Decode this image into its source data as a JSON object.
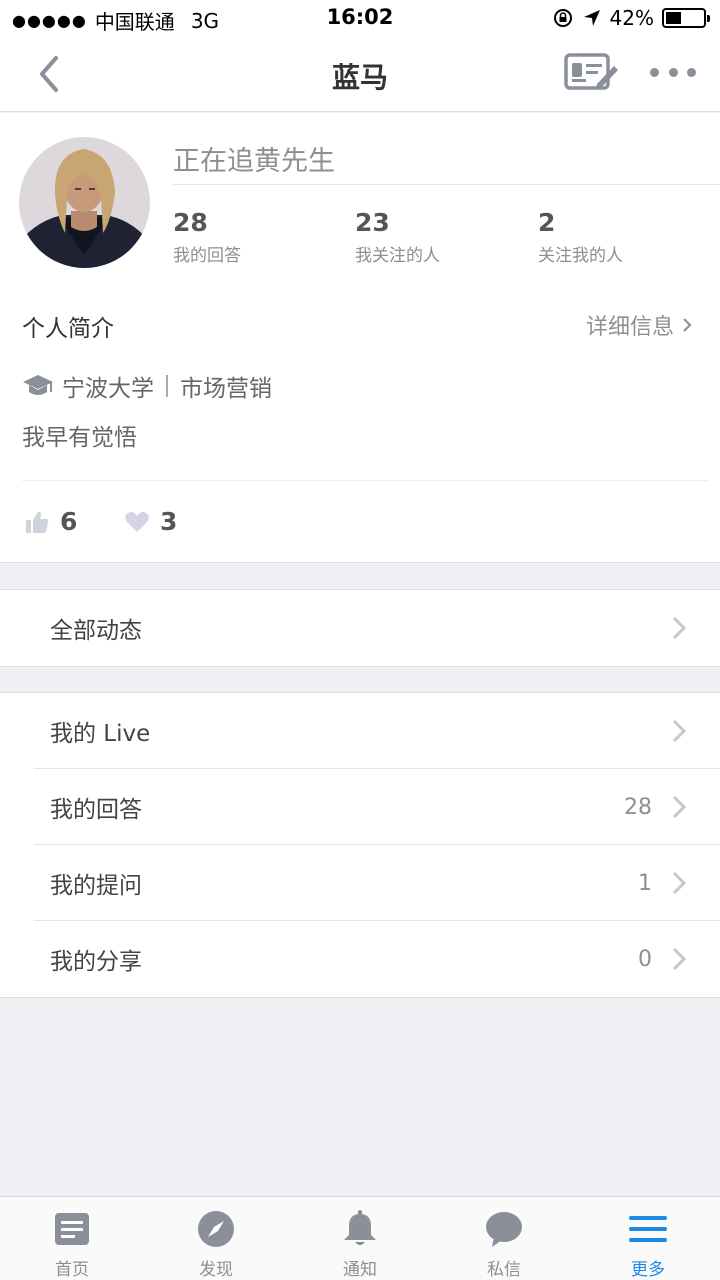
{
  "status_bar": {
    "signal": "●●●●●",
    "carrier": "中国联通",
    "network": "3G",
    "time": "16:02",
    "battery": "42%",
    "battery_level": 0.42
  },
  "nav": {
    "title": "蓝马"
  },
  "profile": {
    "headline": "正在追黄先生",
    "stats": [
      {
        "value": "28",
        "label": "我的回答"
      },
      {
        "value": "23",
        "label": "我关注的人"
      },
      {
        "value": "2",
        "label": "关注我的人"
      }
    ],
    "intro_label": "个人简介",
    "detail_link": "详细信息",
    "school": "宁波大学",
    "major": "市场营销",
    "bio": "我早有觉悟",
    "likes": "6",
    "thanks": "3"
  },
  "activity": {
    "label": "全部动态"
  },
  "menu": [
    {
      "label": "我的 Live",
      "count": ""
    },
    {
      "label": "我的回答",
      "count": "28"
    },
    {
      "label": "我的提问",
      "count": "1"
    },
    {
      "label": "我的分享",
      "count": "0"
    }
  ],
  "tabs": [
    {
      "label": "首页",
      "icon": "home-icon"
    },
    {
      "label": "发现",
      "icon": "compass-icon"
    },
    {
      "label": "通知",
      "icon": "bell-icon"
    },
    {
      "label": "私信",
      "icon": "chat-icon"
    },
    {
      "label": "更多",
      "icon": "menu-icon"
    }
  ],
  "colors": {
    "accent": "#1e8ae8",
    "icon_gray": "#8a8f99",
    "background": "#efeff4"
  }
}
